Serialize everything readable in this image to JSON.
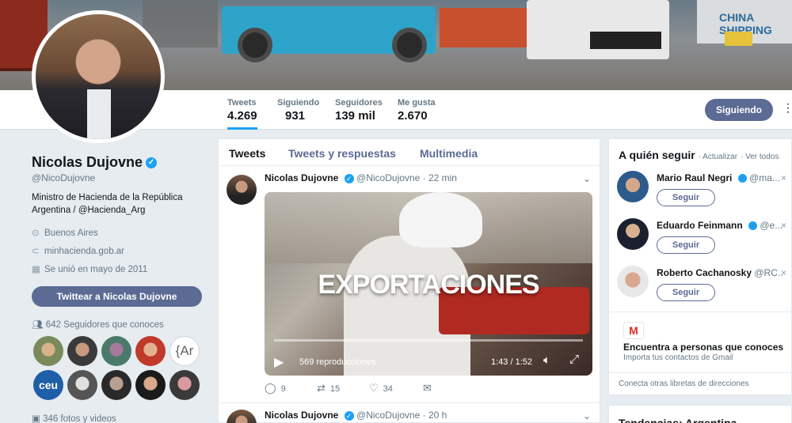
{
  "nav": {
    "stats": [
      {
        "label": "Tweets",
        "value": "4.269"
      },
      {
        "label": "Siguiendo",
        "value": "931"
      },
      {
        "label": "Seguidores",
        "value": "139 mil"
      },
      {
        "label": "Me gusta",
        "value": "2.670"
      }
    ],
    "follow_button": "Siguiendo",
    "more_icon": "⋮"
  },
  "banner": {
    "sign_text": "CHINA SHIPPING"
  },
  "profile": {
    "name": "Nicolas Dujovne",
    "handle": "@NicoDujovne",
    "bio": "Ministro de Hacienda de la República Argentina / @Hacienda_Arg",
    "location": "Buenos Aires",
    "website": "minhacienda.gob.ar",
    "joined": "Se unió en mayo de 2011",
    "tweet_to_button": "Twittear a Nicolas Dujovne",
    "followers_you_know": "642 Seguidores que conoces",
    "photos": "346 fotos y videos"
  },
  "timeline": {
    "tabs": [
      "Tweets",
      "Tweets y respuestas",
      "Multimedia"
    ],
    "tweets": [
      {
        "author": "Nicolas Dujovne",
        "handle": "@NicoDujovne",
        "time": "· 22 min",
        "video": {
          "title": "EXPORTACIONES",
          "views": "569 reproducciones",
          "duration": "1:43 / 1:52"
        },
        "replies": "9",
        "retweets": "15",
        "likes": "34"
      },
      {
        "author": "Nicolas Dujovne",
        "handle": "@NicoDujovne",
        "time": "· 20 h"
      }
    ]
  },
  "who_to_follow": {
    "title": "A quién seguir",
    "refresh": "· Actualizar",
    "view_all": "· Ver todos",
    "suggestions": [
      {
        "name": "Mario Raul Negri",
        "handle": "@ma...",
        "button": "Seguir"
      },
      {
        "name": "Eduardo Feinmann",
        "handle": "@e...",
        "button": "Seguir"
      },
      {
        "name": "Roberto Cachanosky",
        "handle": "@RC...",
        "button": "Seguir"
      }
    ],
    "gmail_icon": "M",
    "find_people": "Encuentra a personas que conoces",
    "import_contacts": "Importa tus contactos de Gmail",
    "connect_other": "Conecta otras libretas de direcciones"
  },
  "trends": {
    "title": "Tendencias: Argentina"
  },
  "colors": {
    "accent": "#1da1f2",
    "button": "#5c6b94"
  }
}
